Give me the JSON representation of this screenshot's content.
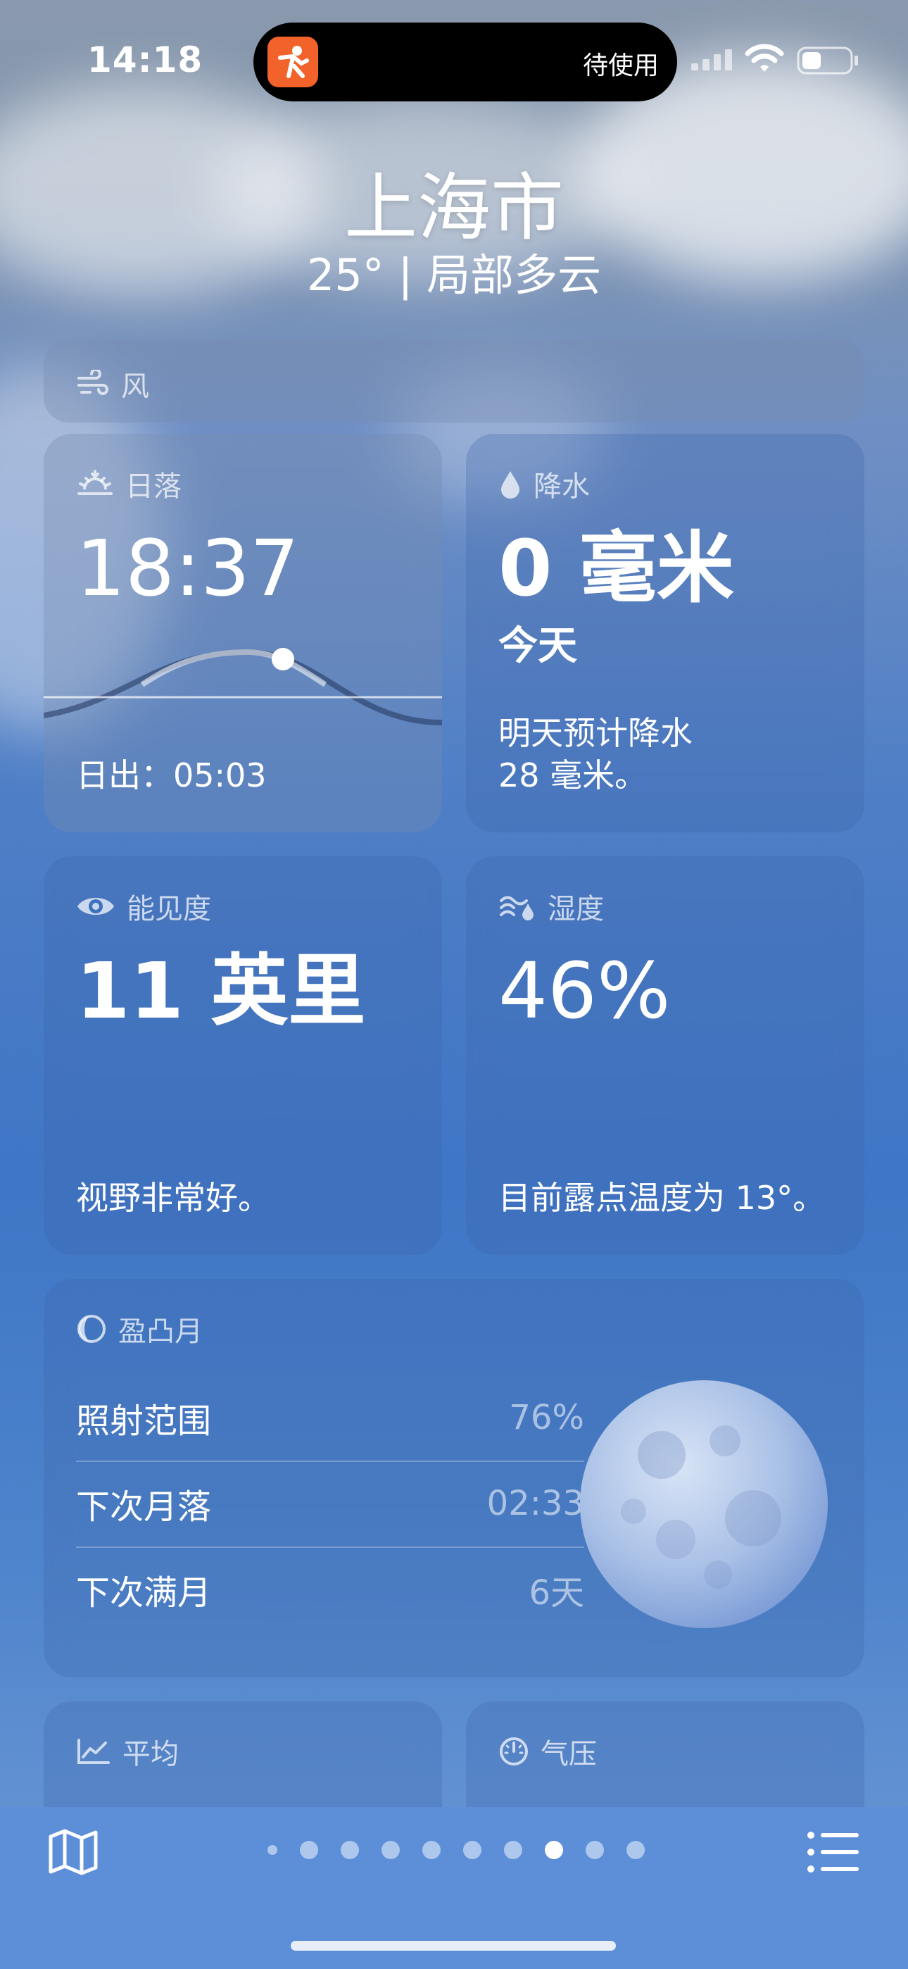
{
  "status_bar": {
    "time": "14:18",
    "island_text": "待使用"
  },
  "header": {
    "city": "上海市",
    "condition": "25° | 局部多云"
  },
  "wind": {
    "title": "风"
  },
  "sunset": {
    "title": "日落",
    "time": "18:37",
    "sunrise": "日出：05:03"
  },
  "precipitation": {
    "title": "降水",
    "amount": "0 毫米",
    "period": "今天",
    "note_line1": "明天预计降水",
    "note_line2": "28 毫米。"
  },
  "visibility": {
    "title": "能见度",
    "value": "11 英里",
    "note": "视野非常好。"
  },
  "humidity": {
    "title": "湿度",
    "value": "46%",
    "note": "目前露点温度为 13°。"
  },
  "moon": {
    "title": "盈凸月",
    "rows": [
      {
        "label": "照射范围",
        "value": "76%"
      },
      {
        "label": "下次月落",
        "value": "02:33"
      },
      {
        "label": "下次满月",
        "value": "6天"
      }
    ]
  },
  "average": {
    "title": "平均"
  },
  "pressure": {
    "title": "气压"
  },
  "page_indicator": {
    "count": 10,
    "active": 7
  },
  "colors": {
    "island_app": "#f2622b",
    "bottom_bar": "#5d8fd8"
  }
}
